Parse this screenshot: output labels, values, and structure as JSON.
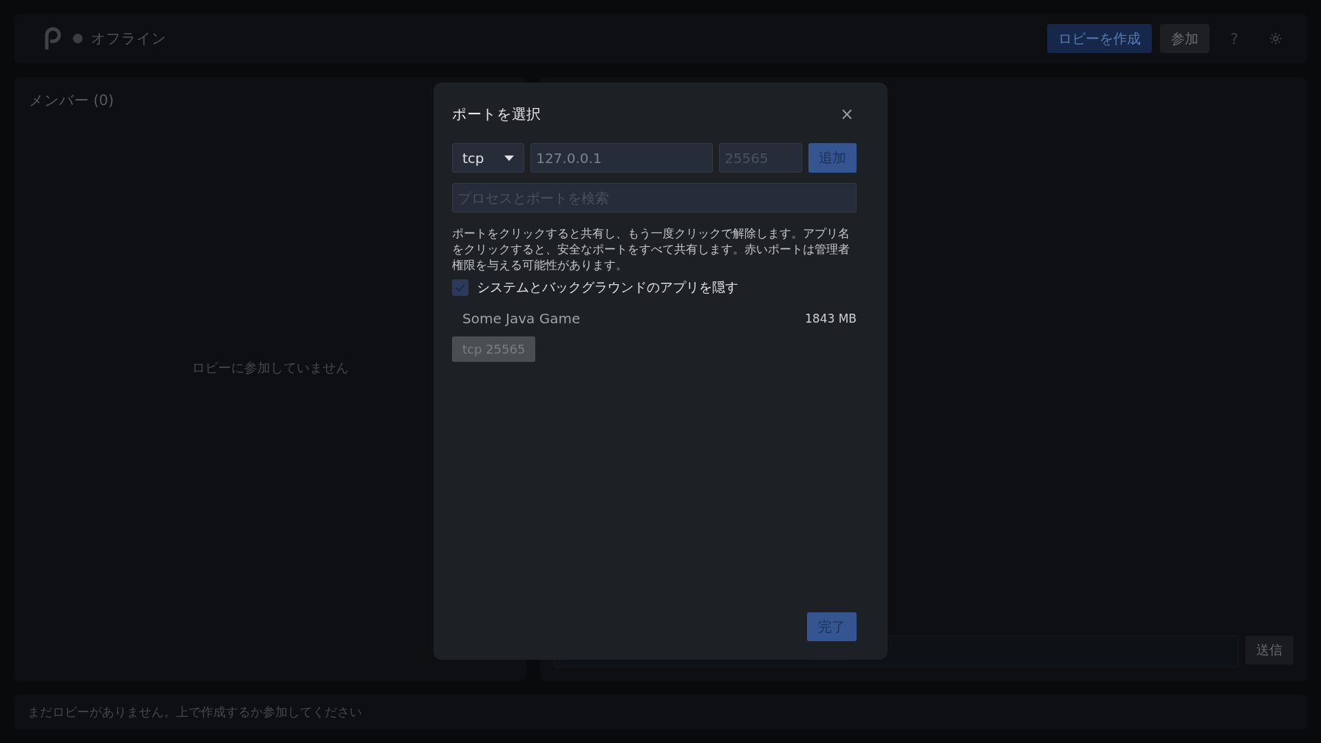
{
  "topbar": {
    "status": {
      "label": "オフライン",
      "online": false
    },
    "buttons": [
      {
        "label": "ロビーを作成",
        "kind": "primary"
      },
      {
        "label": "参加",
        "kind": "secondary"
      }
    ],
    "help": "?"
  },
  "members": {
    "title": "メンバー (0)",
    "empty": "ロビーに参加していません"
  },
  "chat": {
    "send": "送信"
  },
  "status_bar": "まだロビーがありません。上で作成するか参加してください",
  "dialog": {
    "title": "ポートを選択",
    "close": "×",
    "protocol": "tcp",
    "address": "127.0.0.1",
    "port_placeholder": "25565",
    "add": "追加",
    "search_placeholder": "プロセスとポートを検索",
    "help": "ポートをクリックすると共有し、もう一度クリックで解除します。アプリ名をクリックすると、安全なポートをすべて共有します。赤いポートは管理者権限を与える可能性があります。",
    "hide_system": {
      "label": "システムとバックグラウンドのアプリを隠す",
      "checked": true
    },
    "apps": [
      {
        "name": "Some Java Game",
        "memory": "1843 MB",
        "ports": [
          {
            "label": "tcp 25565",
            "shared": false
          }
        ]
      }
    ],
    "done": "完了"
  }
}
